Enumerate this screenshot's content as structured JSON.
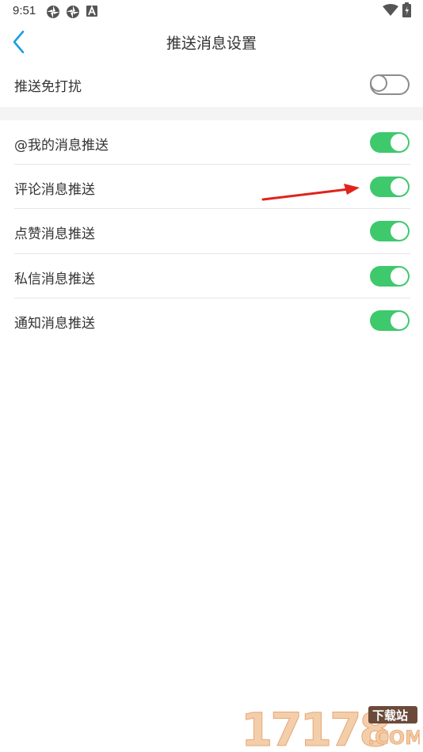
{
  "status_bar": {
    "time": "9:51",
    "left_icons": [
      "aperture-icon",
      "aperture-icon",
      "a-icon"
    ],
    "right_icons": [
      "wifi-icon",
      "battery-icon"
    ]
  },
  "nav": {
    "title": "推送消息设置",
    "back_icon": "chevron-left-icon",
    "accent": "#1a9fe0"
  },
  "dnd": {
    "label": "推送免打扰",
    "enabled": false
  },
  "push_settings": [
    {
      "label": "@我的消息推送",
      "enabled": true
    },
    {
      "label": "评论消息推送",
      "enabled": true
    },
    {
      "label": "点赞消息推送",
      "enabled": true
    },
    {
      "label": "私信消息推送",
      "enabled": true
    },
    {
      "label": "通知消息推送",
      "enabled": true
    }
  ],
  "colors": {
    "toggle_on": "#3ec96d",
    "toggle_off_border": "#8c8c8c",
    "annotation_arrow": "#e0231b",
    "section_gap": "#f4f4f4"
  },
  "watermark": {
    "number": "17178",
    "badge": "下载站",
    "domain": ".COM"
  }
}
